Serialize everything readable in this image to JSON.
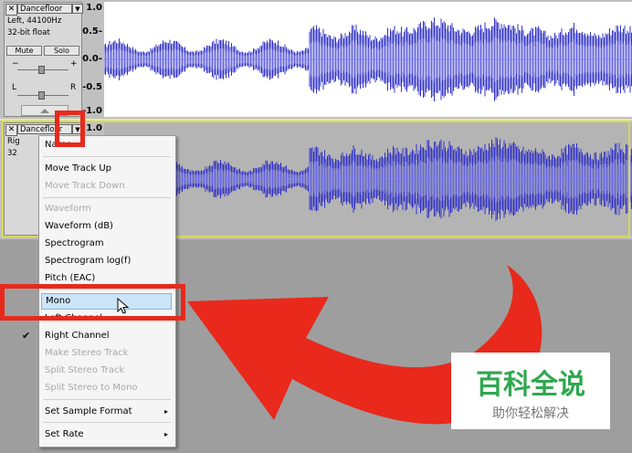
{
  "track1": {
    "close": "✕",
    "name": "Dancefloor",
    "dropdown_arrow": "▼",
    "info_line1": "Left, 44100Hz",
    "info_line2": "32-bit float",
    "mute_label": "Mute",
    "solo_label": "Solo",
    "gain_minus": "−",
    "gain_plus": "+",
    "pan_left": "L",
    "pan_right": "R",
    "ruler": [
      "1.0",
      "0.5-",
      "0.0-",
      "-0.5",
      "-1.0"
    ]
  },
  "track2": {
    "close": "✕",
    "name": "Dancefloor",
    "dropdown_arrow": "▼",
    "info_line1": "Rig",
    "info_line2": "32",
    "ruler_top": "1.0"
  },
  "menu": {
    "items": [
      {
        "label": "Name...",
        "enabled": true
      },
      {
        "label": "Move Track Up",
        "enabled": true
      },
      {
        "label": "Move Track Down",
        "enabled": false
      },
      {
        "label": "Waveform",
        "enabled": false
      },
      {
        "label": "Waveform (dB)",
        "enabled": true
      },
      {
        "label": "Spectrogram",
        "enabled": true
      },
      {
        "label": "Spectrogram log(f)",
        "enabled": true
      },
      {
        "label": "Pitch (EAC)",
        "enabled": true
      },
      {
        "label": "Mono",
        "enabled": true,
        "highlighted": true
      },
      {
        "label": "Left Channel",
        "enabled": true
      },
      {
        "label": "Right Channel",
        "enabled": true,
        "checked": true
      },
      {
        "label": "Make Stereo Track",
        "enabled": false
      },
      {
        "label": "Split Stereo Track",
        "enabled": false
      },
      {
        "label": "Split Stereo to Mono",
        "enabled": false
      },
      {
        "label": "Set Sample Format",
        "enabled": true,
        "submenu": true
      },
      {
        "label": "Set Rate",
        "enabled": true,
        "submenu": true
      }
    ],
    "check_glyph": "✔",
    "submenu_glyph": "▸"
  },
  "watermark": {
    "title": "百科全说",
    "subtitle": "助你轻松解决"
  },
  "colors": {
    "waveform_dark": "#3232c8",
    "waveform_light": "#6464dc",
    "annotation_red": "#e8291c",
    "menu_highlight": "#cce4f7",
    "watermark_green": "#2fa84f"
  }
}
